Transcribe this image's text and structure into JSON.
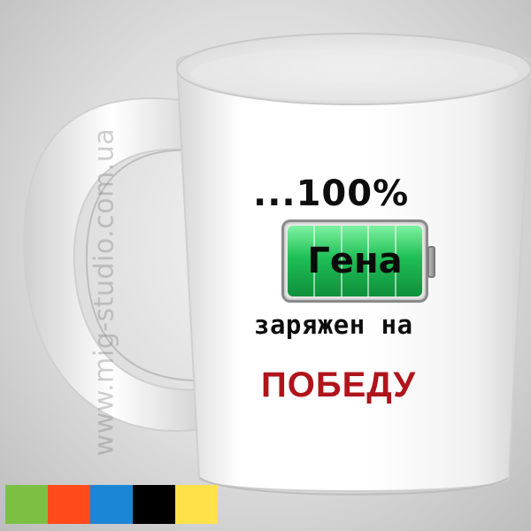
{
  "watermark": "www.mig-studio.com.ua",
  "mug_print": {
    "headline": "...100%",
    "battery_label": "Гена",
    "line2": "заряжен на",
    "line3": "ПОБЕДУ",
    "battery_charge_percent": 100,
    "battery_cells": 5
  },
  "colors": {
    "accent_red": "#b0141b",
    "battery_green": "#1fbf56"
  },
  "color_swatches": [
    {
      "name": "green",
      "hex": "#7bc043"
    },
    {
      "name": "orange-red",
      "hex": "#ff4a1c"
    },
    {
      "name": "blue",
      "hex": "#1b86d6"
    },
    {
      "name": "black",
      "hex": "#000000"
    },
    {
      "name": "yellow",
      "hex": "#ffe14a"
    }
  ]
}
